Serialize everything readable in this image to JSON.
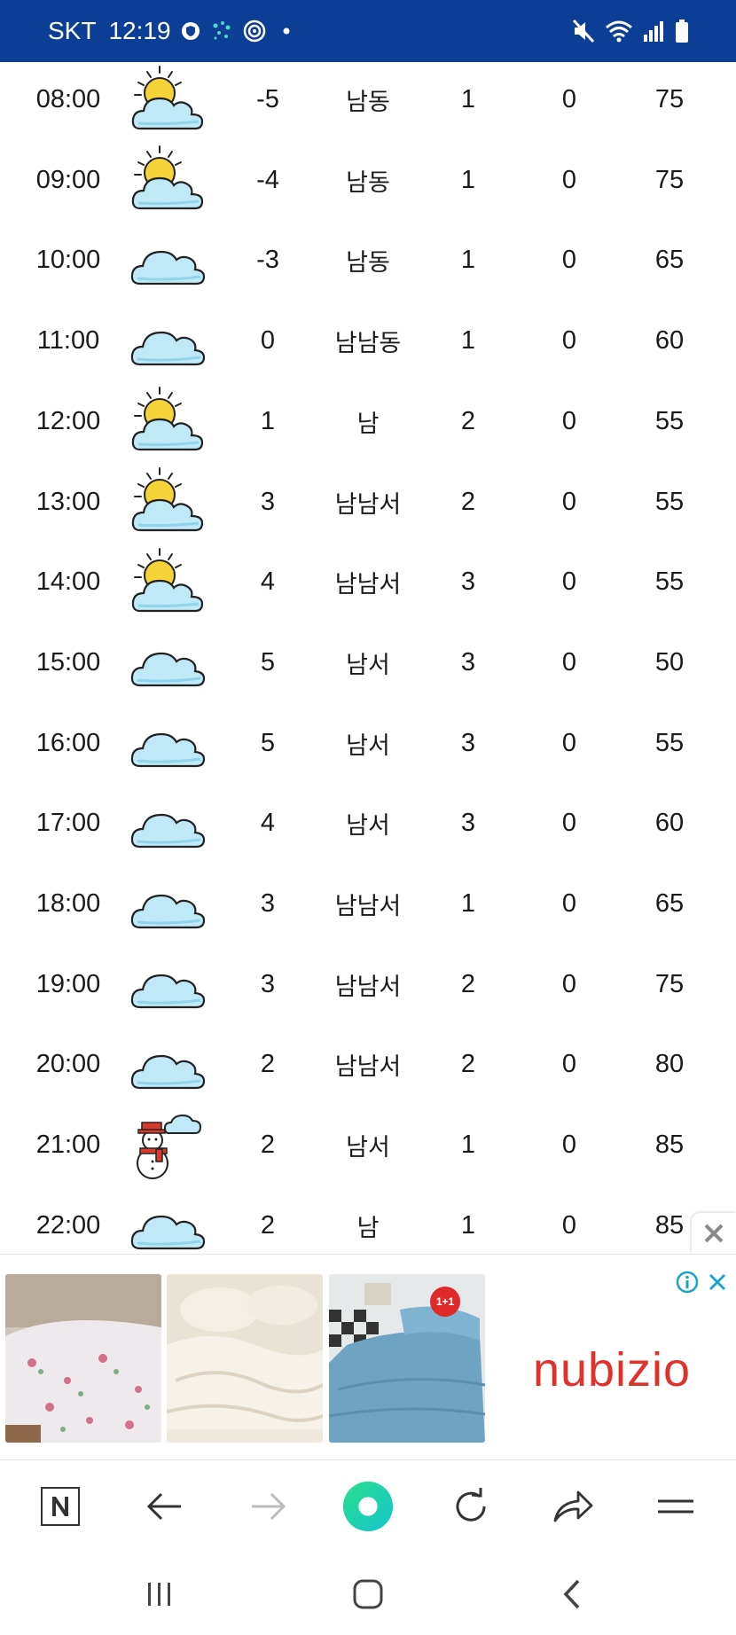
{
  "status_bar": {
    "carrier": "SKT",
    "time": "12:19",
    "left_icons": [
      "vpn-shield-icon",
      "dots-icon",
      "target-icon",
      "dot-icon"
    ],
    "right_icons": [
      "mute-icon",
      "wifi-icon",
      "signal-icon",
      "battery-icon"
    ]
  },
  "weather": {
    "rows": [
      {
        "time": "08:00",
        "icon": "partly-sunny",
        "temp": "-5",
        "wind_dir": "남동",
        "wind_speed": "1",
        "precip": "0",
        "humidity": "75"
      },
      {
        "time": "09:00",
        "icon": "partly-sunny",
        "temp": "-4",
        "wind_dir": "남동",
        "wind_speed": "1",
        "precip": "0",
        "humidity": "75"
      },
      {
        "time": "10:00",
        "icon": "cloudy",
        "temp": "-3",
        "wind_dir": "남동",
        "wind_speed": "1",
        "precip": "0",
        "humidity": "65"
      },
      {
        "time": "11:00",
        "icon": "cloudy",
        "temp": "0",
        "wind_dir": "남남동",
        "wind_speed": "1",
        "precip": "0",
        "humidity": "60"
      },
      {
        "time": "12:00",
        "icon": "partly-sunny",
        "temp": "1",
        "wind_dir": "남",
        "wind_speed": "2",
        "precip": "0",
        "humidity": "55"
      },
      {
        "time": "13:00",
        "icon": "partly-sunny",
        "temp": "3",
        "wind_dir": "남남서",
        "wind_speed": "2",
        "precip": "0",
        "humidity": "55"
      },
      {
        "time": "14:00",
        "icon": "partly-sunny",
        "temp": "4",
        "wind_dir": "남남서",
        "wind_speed": "3",
        "precip": "0",
        "humidity": "55"
      },
      {
        "time": "15:00",
        "icon": "cloudy",
        "temp": "5",
        "wind_dir": "남서",
        "wind_speed": "3",
        "precip": "0",
        "humidity": "50"
      },
      {
        "time": "16:00",
        "icon": "cloudy",
        "temp": "5",
        "wind_dir": "남서",
        "wind_speed": "3",
        "precip": "0",
        "humidity": "55"
      },
      {
        "time": "17:00",
        "icon": "cloudy",
        "temp": "4",
        "wind_dir": "남서",
        "wind_speed": "3",
        "precip": "0",
        "humidity": "60"
      },
      {
        "time": "18:00",
        "icon": "cloudy",
        "temp": "3",
        "wind_dir": "남남서",
        "wind_speed": "1",
        "precip": "0",
        "humidity": "65"
      },
      {
        "time": "19:00",
        "icon": "cloudy",
        "temp": "3",
        "wind_dir": "남남서",
        "wind_speed": "2",
        "precip": "0",
        "humidity": "75"
      },
      {
        "time": "20:00",
        "icon": "cloudy",
        "temp": "2",
        "wind_dir": "남남서",
        "wind_speed": "2",
        "precip": "0",
        "humidity": "80"
      },
      {
        "time": "21:00",
        "icon": "snow",
        "temp": "2",
        "wind_dir": "남서",
        "wind_speed": "1",
        "precip": "0",
        "humidity": "85"
      },
      {
        "time": "22:00",
        "icon": "cloudy",
        "temp": "2",
        "wind_dir": "남",
        "wind_speed": "1",
        "precip": "0",
        "humidity": "85"
      }
    ]
  },
  "ad": {
    "brand": "nubizio",
    "badge": "1+1",
    "icons": [
      "ad-info-icon",
      "ad-close-icon",
      "ad-collapse-icon"
    ]
  },
  "toolbar": {
    "icons": [
      "naver-home-icon",
      "back-arrow-icon",
      "forward-arrow-icon",
      "green-dot-icon",
      "refresh-icon",
      "share-icon",
      "menu-icon"
    ]
  },
  "navbar": {
    "icons": [
      "recent-apps-icon",
      "home-icon",
      "back-icon"
    ]
  },
  "colors": {
    "status_bar": "#0d3e96",
    "cloud_fill": "#bfe9f7",
    "sun_fill": "#f7d33a",
    "brand_red": "#e0312b",
    "toolbar_green": "#1dd7a2"
  }
}
